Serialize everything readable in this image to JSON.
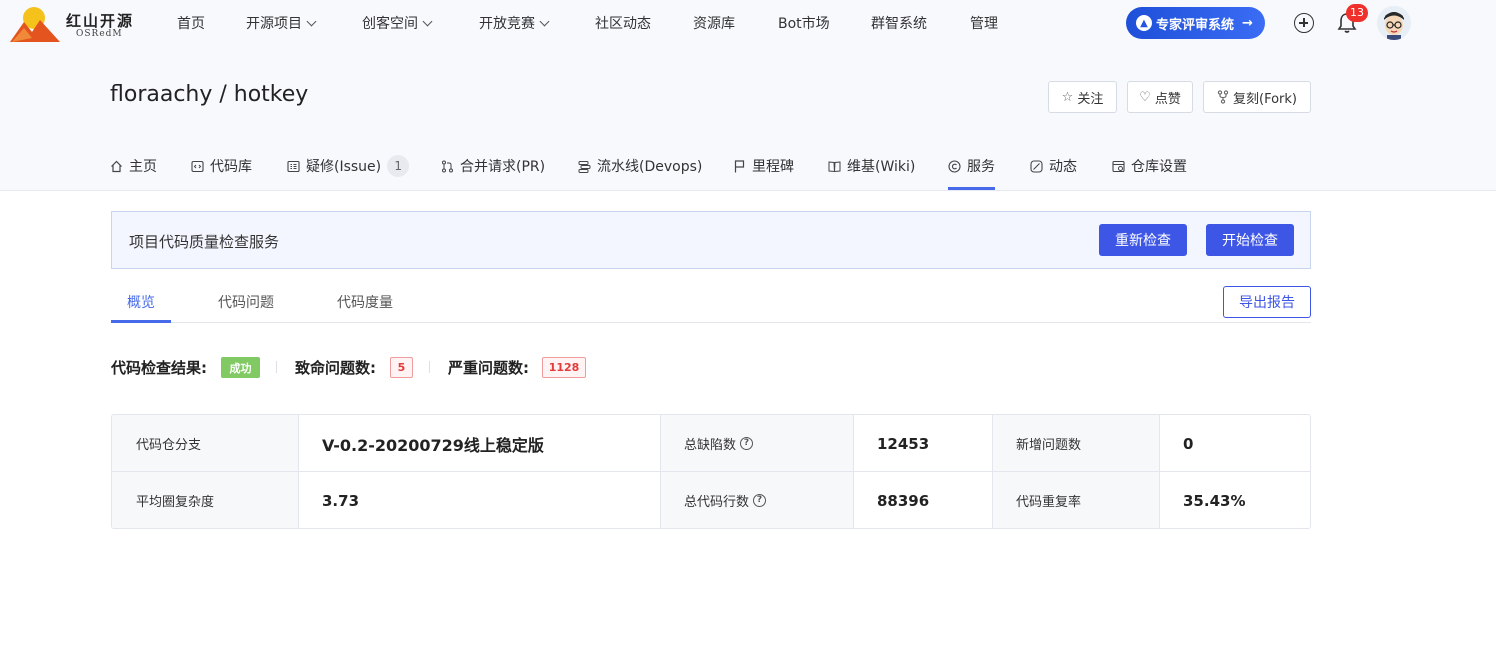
{
  "brand": {
    "name_cn": "红山开源",
    "name_en": "OSRedM"
  },
  "nav": {
    "items": [
      {
        "label": "首页",
        "has_dropdown": false
      },
      {
        "label": "开源项目",
        "has_dropdown": true
      },
      {
        "label": "创客空间",
        "has_dropdown": true
      },
      {
        "label": "开放竞赛",
        "has_dropdown": true
      },
      {
        "label": "社区动态",
        "has_dropdown": false
      },
      {
        "label": "资源库",
        "has_dropdown": false
      },
      {
        "label": "Bot市场",
        "has_dropdown": false
      },
      {
        "label": "群智系统",
        "has_dropdown": false
      },
      {
        "label": "管理",
        "has_dropdown": false
      }
    ],
    "expert_button": "专家评审系统",
    "notification_count": "13"
  },
  "repo": {
    "title": "floraachy / hotkey",
    "actions": {
      "watch": "关注",
      "like": "点赞",
      "fork": "复刻(Fork)"
    }
  },
  "repo_tabs": [
    {
      "label": "主页",
      "icon": "home-icon"
    },
    {
      "label": "代码库",
      "icon": "code-icon"
    },
    {
      "label": "疑修(Issue)",
      "icon": "issue-icon",
      "count": "1"
    },
    {
      "label": "合并请求(PR)",
      "icon": "pull-request-icon"
    },
    {
      "label": "流水线(Devops)",
      "icon": "pipeline-icon"
    },
    {
      "label": "里程碑",
      "icon": "flag-icon"
    },
    {
      "label": "维基(Wiki)",
      "icon": "book-icon"
    },
    {
      "label": "服务",
      "icon": "service-icon",
      "active": true
    },
    {
      "label": "动态",
      "icon": "activity-icon"
    },
    {
      "label": "仓库设置",
      "icon": "settings-icon"
    }
  ],
  "service": {
    "title": "项目代码质量检查服务",
    "recheck_label": "重新检查",
    "start_label": "开始检查"
  },
  "sub_tabs": {
    "items": [
      "概览",
      "代码问题",
      "代码度量"
    ],
    "active": "概览",
    "export_label": "导出报告"
  },
  "result": {
    "check_result_label": "代码检查结果:",
    "check_result_value": "成功",
    "fatal_label": "致命问题数:",
    "fatal_value": "5",
    "severe_label": "严重问题数:",
    "severe_value": "1128"
  },
  "stats": {
    "branch_label": "代码仓分支",
    "branch_value": "V-0.2-20200729线上稳定版",
    "total_defects_label": "总缺陷数",
    "total_defects_value": "12453",
    "new_issues_label": "新增问题数",
    "new_issues_value": "0",
    "avg_complexity_label": "平均圈复杂度",
    "avg_complexity_value": "3.73",
    "total_lines_label": "总代码行数",
    "total_lines_value": "88396",
    "dup_rate_label": "代码重复率",
    "dup_rate_value": "35.43%"
  },
  "colors": {
    "primary": "#3e56e6",
    "success": "#81c963",
    "danger": "#e33b3b",
    "badge": "#f0302a"
  }
}
